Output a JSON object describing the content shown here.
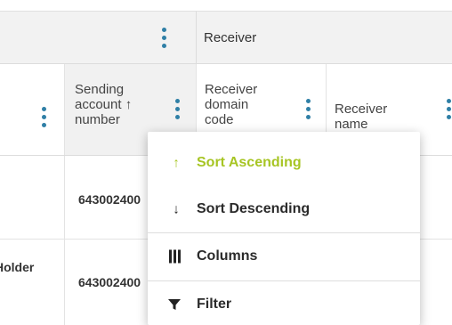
{
  "group_header": {
    "receiver_label": "Receiver"
  },
  "columns": [
    {
      "label": "",
      "icon": "kebab-menu-icon"
    },
    {
      "label_line1": "Sending",
      "label_line2": "account ↑",
      "label_line3": "number",
      "sorted": "ascending",
      "icon": "kebab-menu-icon"
    },
    {
      "label_line1": "Receiver",
      "label_line2": "domain",
      "label_line3": "code",
      "icon": "kebab-menu-icon"
    },
    {
      "label_line1": "Receiver",
      "label_line2": "name",
      "icon": "kebab-menu-icon"
    }
  ],
  "rows": [
    {
      "col1": "",
      "sending_account_number": "643002400"
    },
    {
      "col1": "Holder",
      "sending_account_number": "643002400"
    }
  ],
  "column_menu": {
    "items": [
      {
        "label": "Sort Ascending",
        "icon": "arrow-up-icon",
        "glyph": "↑",
        "active": true
      },
      {
        "label": "Sort Descending",
        "icon": "arrow-down-icon",
        "glyph": "↓",
        "active": false
      },
      {
        "label": "Columns",
        "icon": "columns-icon",
        "active": false
      },
      {
        "label": "Filter",
        "icon": "filter-icon",
        "active": false
      }
    ]
  },
  "colors": {
    "accent_active": "#a7c524",
    "kebab": "#2f7fa6",
    "header_background": "#f2f2f2"
  }
}
